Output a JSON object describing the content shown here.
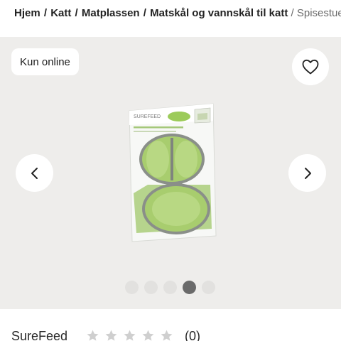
{
  "breadcrumb": {
    "items": [
      "Hjem",
      "Katt",
      "Matplassen",
      "Matskål og vannskål til katt"
    ],
    "separator": "/",
    "current": "Spisestue"
  },
  "gallery": {
    "badge_label": "Kun online",
    "favorite_icon": "heart-outline-icon",
    "prev_icon": "chevron-left-icon",
    "next_icon": "chevron-right-icon",
    "dot_count": 5,
    "active_dot_index": 3
  },
  "product_image": {
    "brand_mark": "SUREFEED",
    "package_line1": "Microchip Pet Feeder Mat and Bowl Set",
    "accent_color": "#9ccb5a",
    "bowl_color": "#a8cd6e",
    "background_color": "#eeedeb"
  },
  "product": {
    "brand": "SureFeed",
    "rating": 0,
    "rating_max": 5,
    "review_count": "(0)"
  },
  "colors": {
    "star_empty": "#cfcfcf",
    "dot_active": "#6a6a6a",
    "dot_inactive": "#e2e1df"
  }
}
